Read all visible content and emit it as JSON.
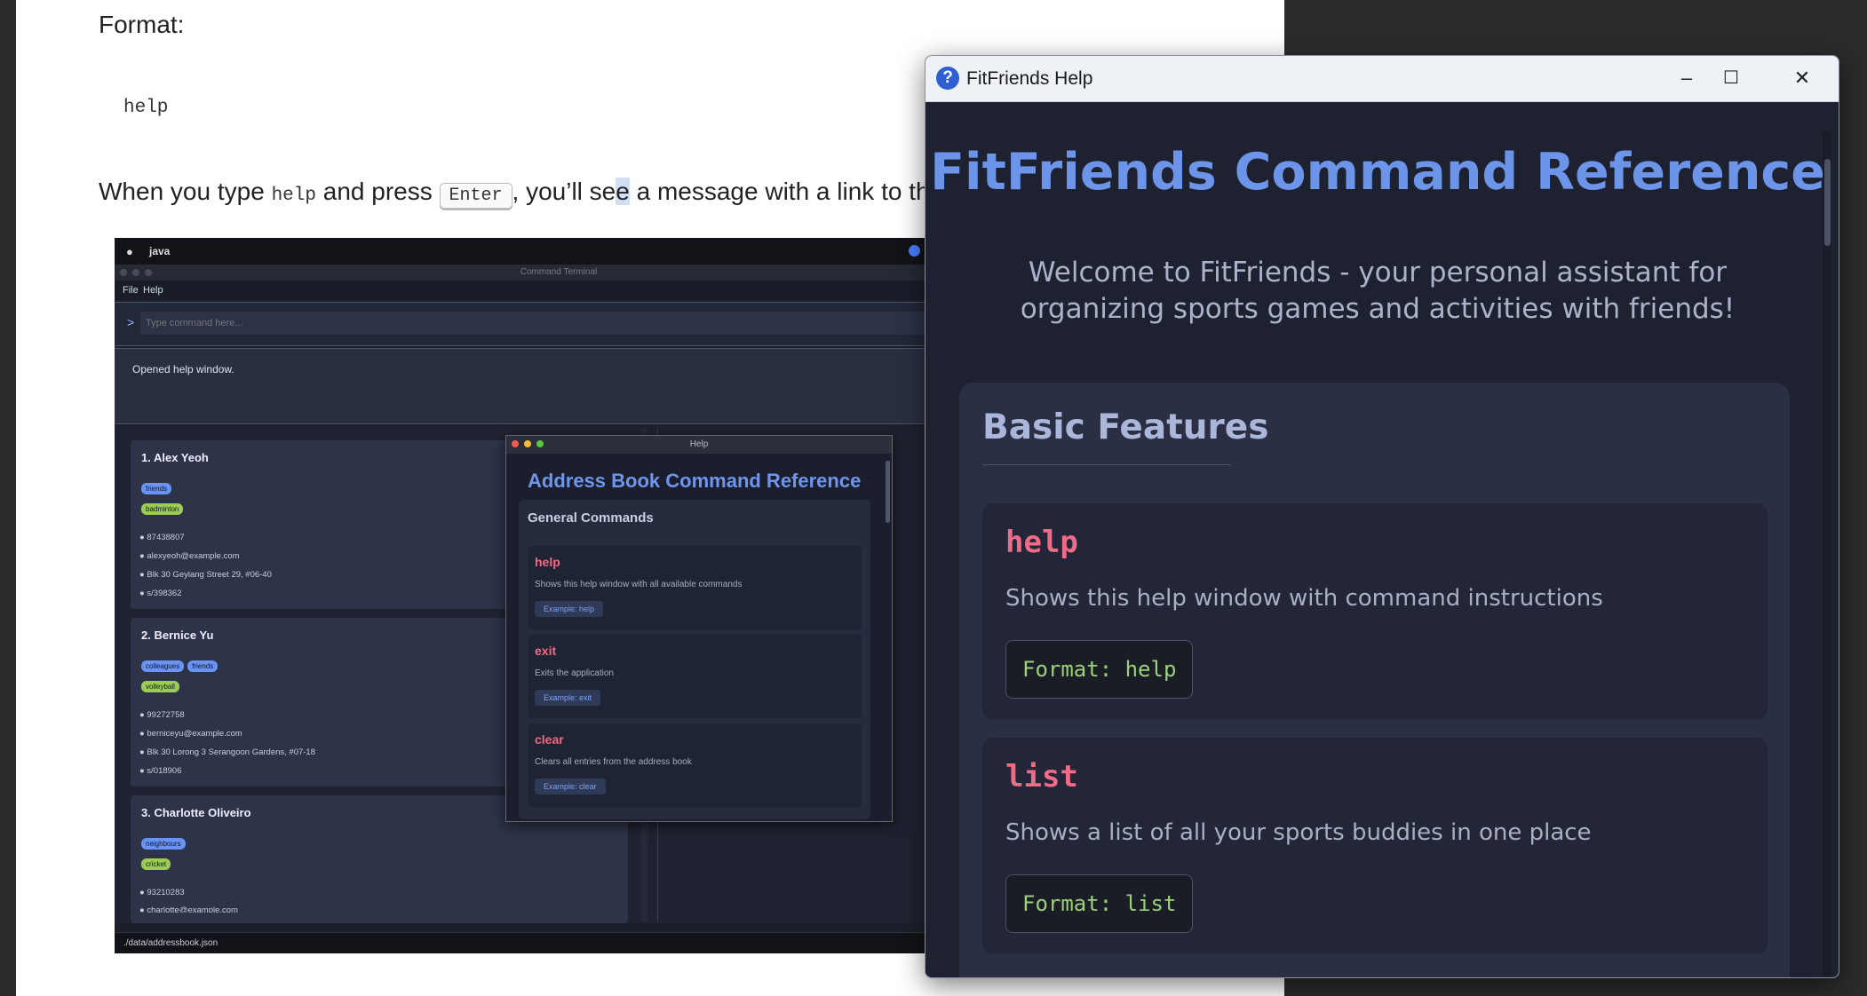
{
  "document": {
    "format_label": "Format:",
    "code_sample": "help",
    "para_before": "When you type ",
    "para_code": "help",
    "para_mid": " and press ",
    "para_key": "Enter",
    "para_after_a": ", you’ll se",
    "para_hl": "e",
    "para_after_b": " a message with a link to th"
  },
  "inner_app": {
    "app_name": "java",
    "window_title": "Command Terminal",
    "menu": [
      "File",
      "Help"
    ],
    "prompt": ">",
    "command_placeholder": "Type command here...",
    "result_message": "Opened help window.",
    "persons": [
      {
        "name": "1.  Alex Yeoh",
        "tags": [
          {
            "label": "friends",
            "color": "blue"
          },
          {
            "label": "badminton",
            "color": "green"
          }
        ],
        "phone": "87438807",
        "email": "alexyeoh@example.com",
        "address": "Blk 30 Geylang Street 29, #06-40",
        "postal": "s/398362"
      },
      {
        "name": "2.  Bernice Yu",
        "tags": [
          {
            "label": "colleagues",
            "color": "blue"
          },
          {
            "label": "friends",
            "color": "blue"
          },
          {
            "label": "volleyball",
            "color": "green"
          }
        ],
        "phone": "99272758",
        "email": "berniceyu@example.com",
        "address": "Blk 30 Lorong 3 Serangoon Gardens, #07-18",
        "postal": "s/018906"
      },
      {
        "name": "3.  Charlotte Oliveiro",
        "tags": [
          {
            "label": "neighbours",
            "color": "blue"
          },
          {
            "label": "cricket",
            "color": "green"
          }
        ],
        "phone": "93210283",
        "email": "charlotte@example.com"
      }
    ],
    "status_path": "./data/addressbook.json",
    "mini_help": {
      "title_bar": "Help",
      "heading": "Address Book Command Reference",
      "section": "General Commands",
      "commands": [
        {
          "name": "help",
          "desc": "Shows this help window with all available commands",
          "example": "Example: help"
        },
        {
          "name": "exit",
          "desc": "Exits the application",
          "example": "Example: exit"
        },
        {
          "name": "clear",
          "desc": "Clears all entries from the address book",
          "example": "Example: clear"
        }
      ]
    }
  },
  "help_window": {
    "title": "FitFriends Help",
    "controls": {
      "minimize": "–",
      "maximize": "☐",
      "close": "✕"
    },
    "heading": "FitFriends Command Reference",
    "intro": "Welcome to FitFriends - your personal assistant for organizing sports games and activities with friends!",
    "section_title": "Basic Features",
    "commands": [
      {
        "name": "help",
        "desc": "Shows this help window with command instructions",
        "format": "Format: help"
      },
      {
        "name": "list",
        "desc": "Shows a list of all your sports buddies in one place",
        "format": "Format: list"
      }
    ],
    "colors": {
      "heading": "#6c94e8",
      "command": "#ef6b86",
      "format": "#9cd17a",
      "background": "#1e2130"
    }
  }
}
